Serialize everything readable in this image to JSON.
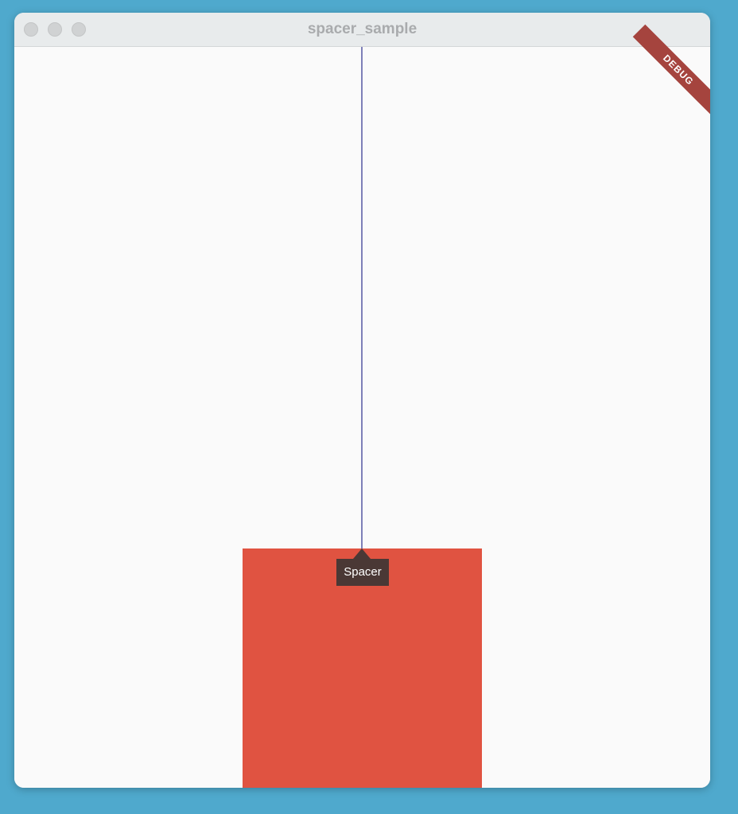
{
  "window": {
    "title": "spacer_sample"
  },
  "content": {
    "tooltip_label": "Spacer",
    "debug_label": "DEBUG"
  },
  "colors": {
    "desktop_background": "#4fa9cd",
    "window_background": "#fafafa",
    "titlebar_background": "#e8ebec",
    "guide_line": "#7d7fb8",
    "red_box": "#e05341",
    "tooltip_background": "#4a3835",
    "debug_banner": "#a5443e"
  },
  "icons": {
    "traffic_lights": [
      "close-button-icon",
      "minimize-button-icon",
      "maximize-button-icon"
    ]
  }
}
